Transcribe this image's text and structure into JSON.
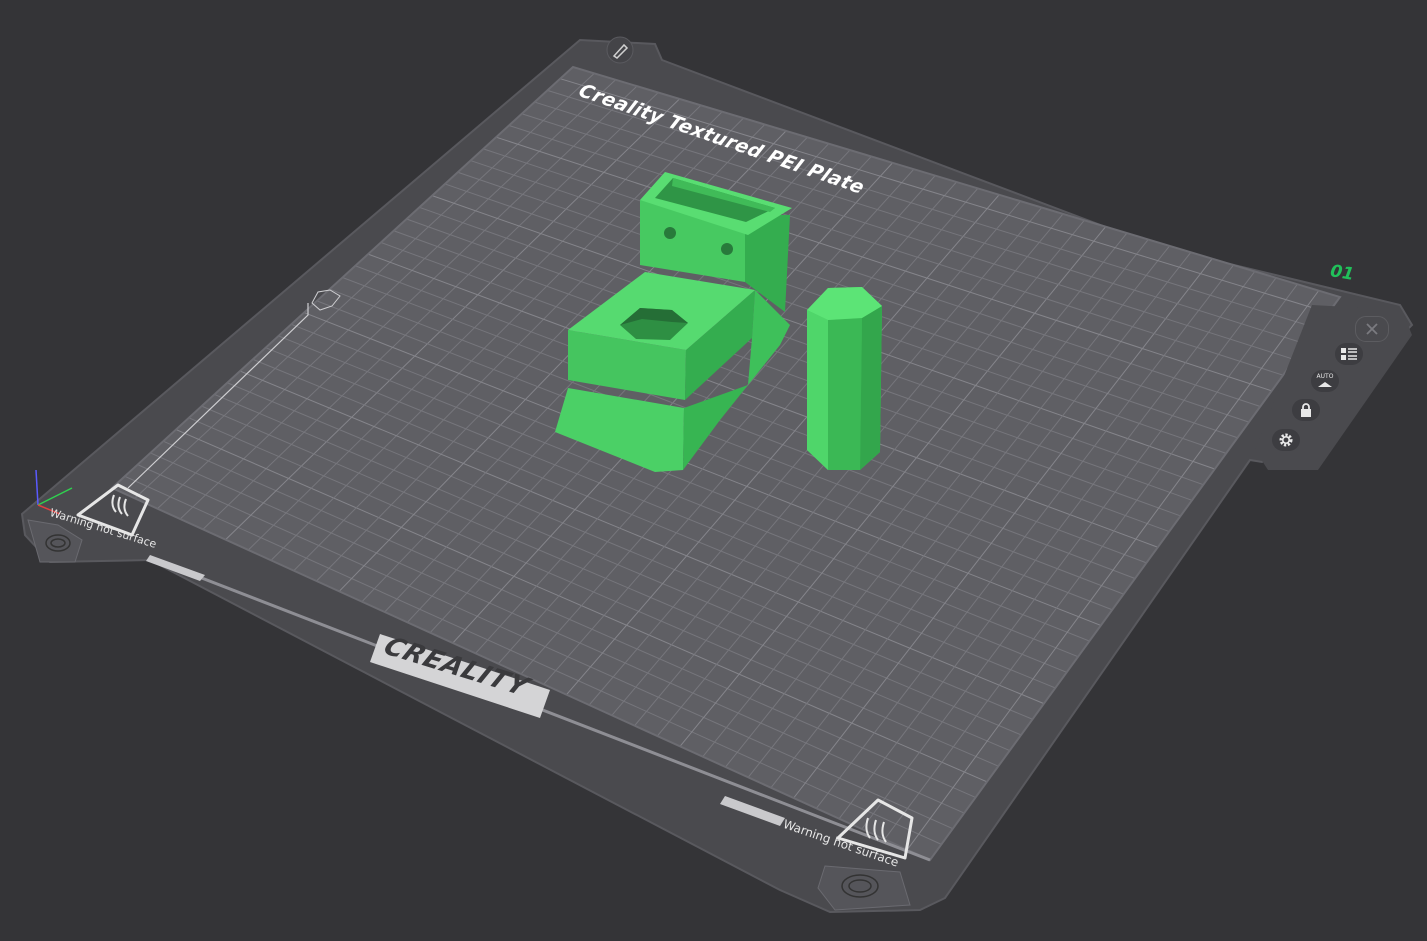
{
  "plate": {
    "title": "Creality Textured PEI Plate",
    "index": "01",
    "brand": "CREALITY",
    "warning_left": "Warning hot surface",
    "warning_right": "Warning hot surface"
  },
  "toolbar": {
    "buttons": [
      {
        "name": "close-plate-button",
        "icon": "close-icon"
      },
      {
        "name": "arrange-list-button",
        "icon": "list-icon"
      },
      {
        "name": "auto-orient-button",
        "icon": "auto-orient-icon",
        "label": "AUTO"
      },
      {
        "name": "lock-plate-button",
        "icon": "lock-icon"
      },
      {
        "name": "plate-settings-button",
        "icon": "gear-icon"
      }
    ],
    "edit_plate_name_icon": "pencil-icon"
  },
  "colors": {
    "background": "#343437",
    "frame": "#4a4a4e",
    "bed": "#5f5f64",
    "grid": "#7a7a80",
    "model": "#4fd36a",
    "accent": "#21c05a"
  }
}
